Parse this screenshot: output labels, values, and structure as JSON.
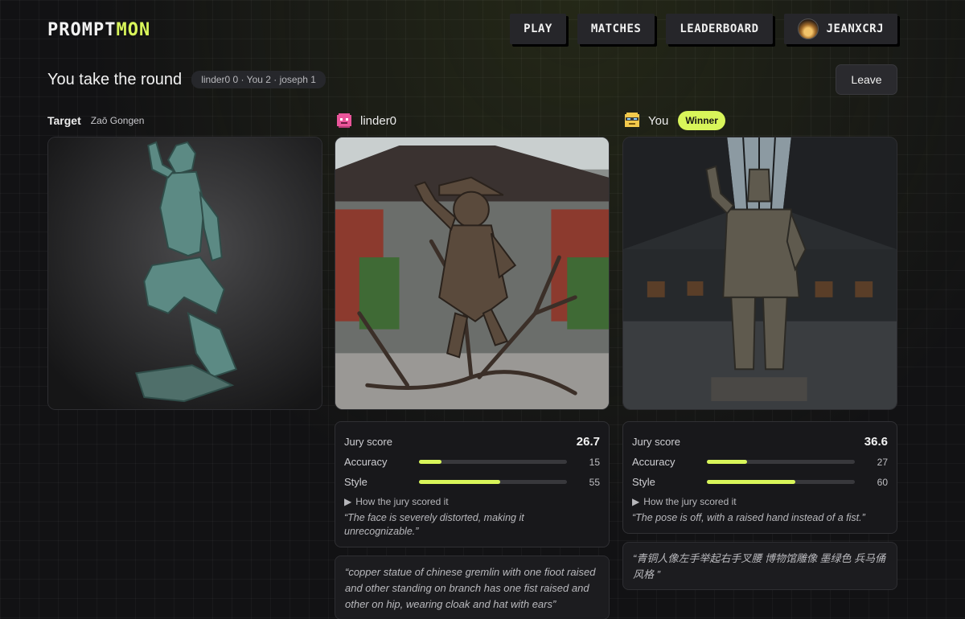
{
  "header": {
    "logo_main": "PROMPT",
    "logo_accent": "MON",
    "nav": [
      "PLAY",
      "MATCHES",
      "LEADERBOARD"
    ],
    "user": "JEANXCRJ"
  },
  "round": {
    "title": "You take the round",
    "scoreline": "linder0 0 · You 2 · joseph 1",
    "leave_label": "Leave"
  },
  "target": {
    "label": "Target",
    "name": "Zaō Gongen"
  },
  "players": [
    {
      "name": "linder0",
      "jury_label": "Jury score",
      "total": "26.7",
      "accuracy_label": "Accuracy",
      "accuracy": 15,
      "style_label": "Style",
      "style": 55,
      "expander": "How the jury scored it",
      "jury_quote": "“The face is severely distorted, making it unrecognizable.”",
      "prompt": "“copper statue of chinese gremlin with one fioot raised and other standing on branch has one fist raised and other on hip, wearing cloak and hat with ears”"
    },
    {
      "name": "You",
      "badge": "Winner",
      "jury_label": "Jury score",
      "total": "36.6",
      "accuracy_label": "Accuracy",
      "accuracy": 27,
      "style_label": "Style",
      "style": 60,
      "expander": "How the jury scored it",
      "jury_quote": "“The pose is off, with a raised hand instead of a fist.”",
      "prompt": "“青铜人像左手举起右手叉腰 博物馆雕像 墨绿色 兵马俑风格 ”"
    }
  ],
  "colors": {
    "accent": "#d8f55a",
    "background": "#121214",
    "card": "#18181b"
  }
}
